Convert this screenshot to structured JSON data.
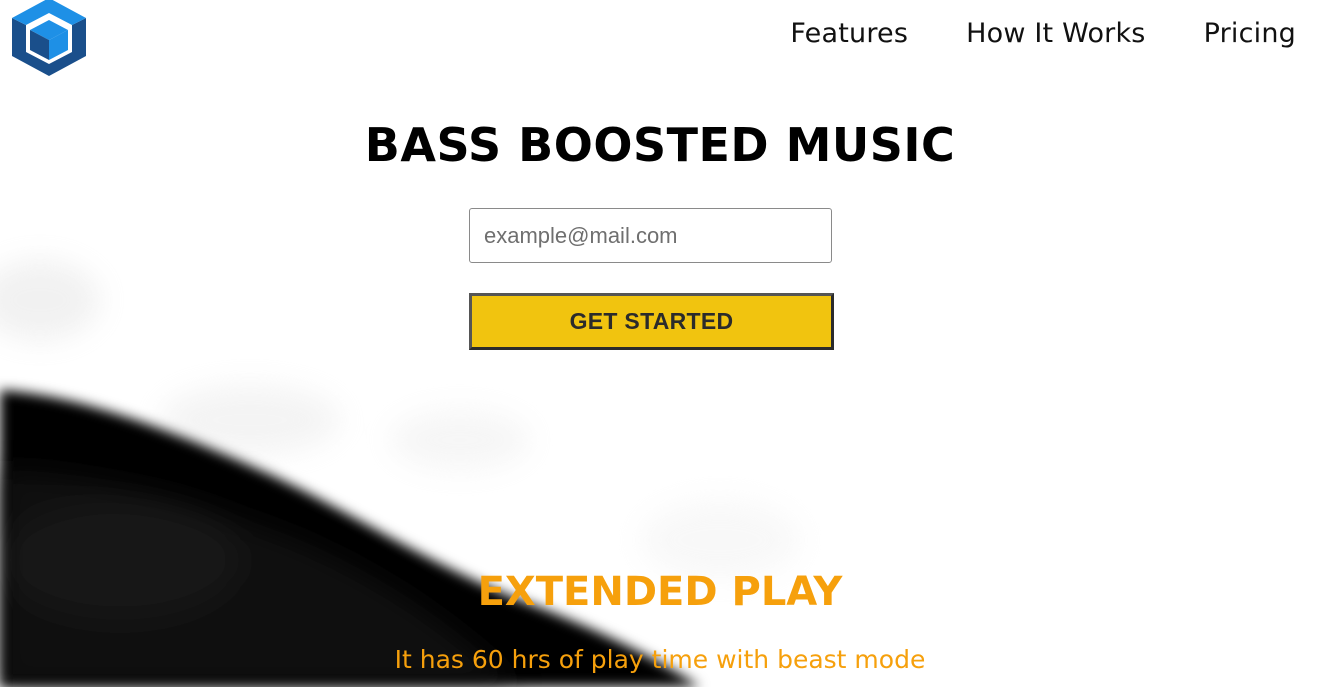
{
  "brand": {
    "logo_icon": "cube-icon",
    "colors": {
      "logo_dark": "#1a4f8b",
      "logo_light": "#1e90e6"
    }
  },
  "nav": {
    "items": [
      {
        "label": "Features"
      },
      {
        "label": "How It Works"
      },
      {
        "label": "Pricing"
      }
    ]
  },
  "hero": {
    "title": "BASS BOOSTED MUSIC",
    "email_placeholder": "example@mail.com",
    "email_value": "",
    "cta_label": "GET STARTED",
    "cta_color": "#f1c40f"
  },
  "feature": {
    "title": "EXTENDED PLAY",
    "description": "It has 60 hrs of play time with beast mode",
    "accent_color": "#f6a00c"
  }
}
